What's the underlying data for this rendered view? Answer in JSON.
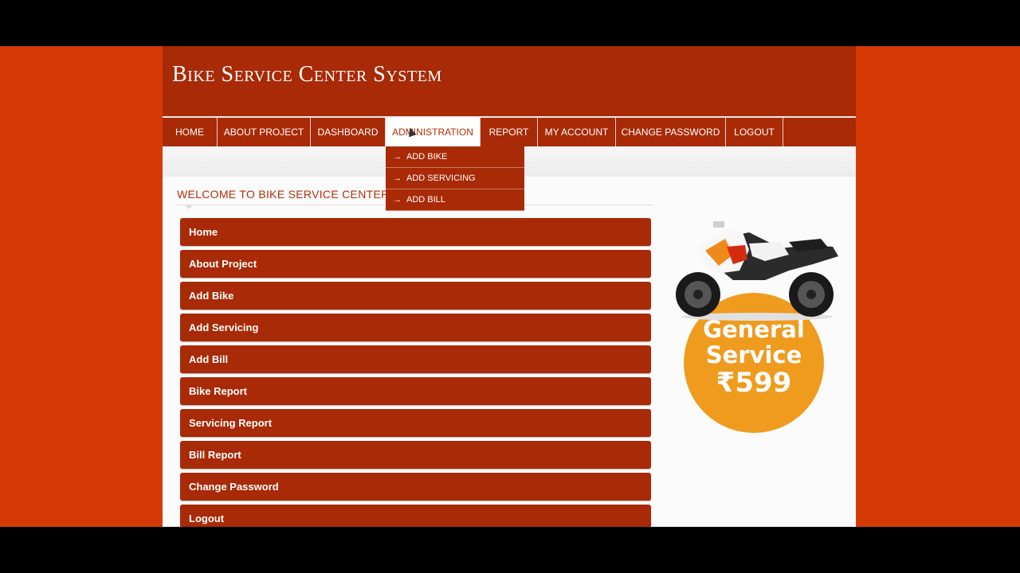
{
  "site": {
    "title": "Bike Service Center System"
  },
  "nav": {
    "items": [
      {
        "label": "HOME"
      },
      {
        "label": "ABOUT PROJECT"
      },
      {
        "label": "DASHBOARD"
      },
      {
        "label": "ADMINISTRATION"
      },
      {
        "label": "REPORT"
      },
      {
        "label": "MY ACCOUNT"
      },
      {
        "label": "CHANGE PASSWORD"
      },
      {
        "label": "LOGOUT"
      }
    ],
    "active": "ADMINISTRATION"
  },
  "dropdown": {
    "arrow": "→",
    "items": [
      {
        "label": "ADD BIKE"
      },
      {
        "label": "ADD SERVICING"
      },
      {
        "label": "ADD BILL"
      }
    ]
  },
  "welcome": {
    "text": "WELCOME TO BIKE SERVICE CENTER SYS"
  },
  "menu": {
    "items": [
      {
        "label": "Home"
      },
      {
        "label": "About Project"
      },
      {
        "label": "Add Bike"
      },
      {
        "label": "Add Servicing"
      },
      {
        "label": "Add Bill"
      },
      {
        "label": "Bike Report"
      },
      {
        "label": "Servicing Report"
      },
      {
        "label": "Bill Report"
      },
      {
        "label": "Change Password"
      },
      {
        "label": "Logout"
      }
    ]
  },
  "promo": {
    "line1": "General",
    "line2": "Service",
    "price": "₹599"
  },
  "colors": {
    "brand": "#a82a06",
    "background": "#d63a05",
    "accent": "#ef9b1e"
  }
}
